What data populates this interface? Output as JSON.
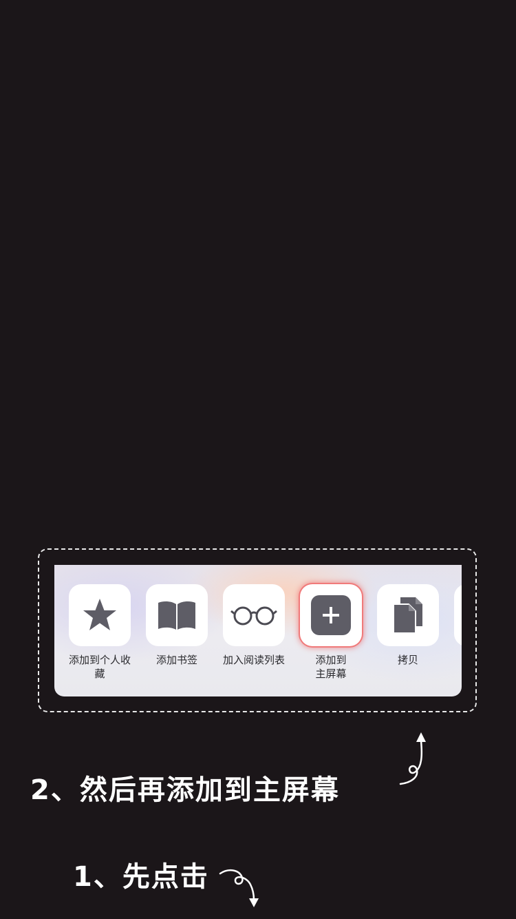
{
  "share_sheet": {
    "actions": [
      {
        "label_line1": "添加到个人收",
        "label_line2": "藏",
        "icon": "star-icon"
      },
      {
        "label_line1": "添加书签",
        "label_line2": "",
        "icon": "book-icon"
      },
      {
        "label_line1": "加入阅读列表",
        "label_line2": "",
        "icon": "glasses-icon"
      },
      {
        "label_line1": "添加到",
        "label_line2": "主屏幕",
        "icon": "plus-icon"
      },
      {
        "label_line1": "拷贝",
        "label_line2": "",
        "icon": "copy-icon"
      }
    ]
  },
  "instructions": {
    "step2": "2、然后再添加到主屏幕",
    "step1": "1、先点击"
  },
  "colors": {
    "background": "#1b1619",
    "icon_gray": "#5e5d66",
    "highlight": "#f07a7a",
    "annotation": "#ffffff"
  }
}
